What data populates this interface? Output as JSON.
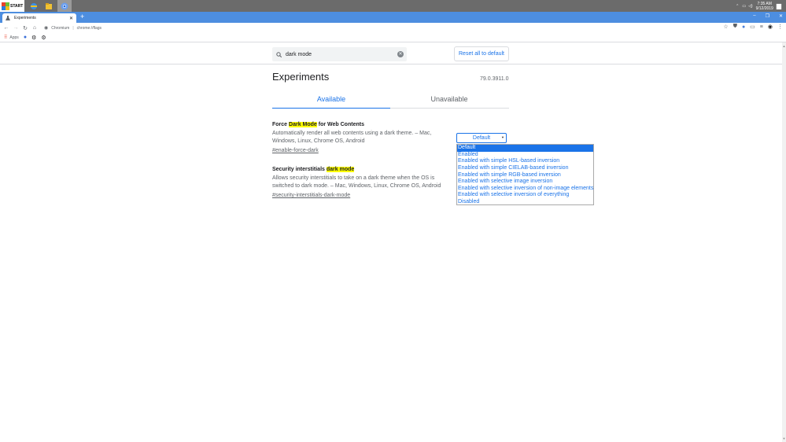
{
  "taskbar": {
    "start_label": "START",
    "clock_time": "7:35 AM",
    "clock_date": "9/12/2019"
  },
  "browser": {
    "tab_title": "Experiments",
    "new_tab": "+",
    "omnibox_site": "Chromium",
    "omnibox_url": "chrome://flags",
    "bookmarks": {
      "apps_label": "Apps"
    }
  },
  "flags": {
    "search_value": "dark mode",
    "reset_label": "Reset all to default",
    "title": "Experiments",
    "version": "79.0.3911.0",
    "tabs": [
      {
        "label": "Available"
      },
      {
        "label": "Unavailable"
      }
    ],
    "experiments": [
      {
        "name_before": "Force ",
        "name_highlight": "Dark Mode",
        "name_after": " for Web Contents",
        "description": "Automatically render all web contents using a dark theme. – Mac, Windows, Linux, Chrome OS, Android",
        "permalink": "#enable-force-dark"
      },
      {
        "name_before": "Security interstitials ",
        "name_highlight": "dark mode",
        "name_after": "",
        "description": "Allows security interstitials to take on a dark theme when the OS is switched to dark mode. – Mac, Windows, Linux, Chrome OS, Android",
        "permalink": "#security-interstitials-dark-mode"
      }
    ],
    "select_value": "Default",
    "dropdown_options": [
      "Default",
      "Enabled",
      "Enabled with simple HSL-based inversion",
      "Enabled with simple CIELAB-based inversion",
      "Enabled with simple RGB-based inversion",
      "Enabled with selective image inversion",
      "Enabled with selective inversion of non-image elements",
      "Enabled with selective inversion of everything",
      "Disabled"
    ],
    "selected_index": 0
  },
  "colors": {
    "accent": "#1a73e8",
    "highlight": "#ffff00",
    "chrome_frame": "#4d8ee0",
    "taskbar": "#6b6b6b"
  }
}
